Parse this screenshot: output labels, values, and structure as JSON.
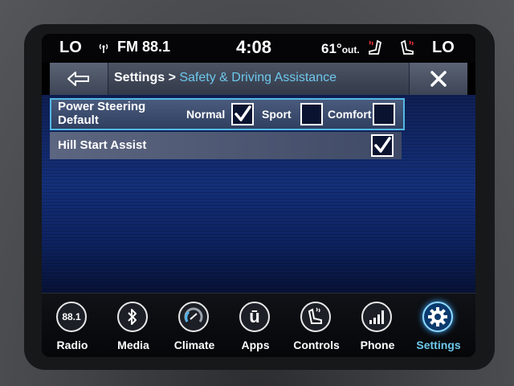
{
  "status_bar": {
    "left_fan": "LO",
    "radio": "FM 88.1",
    "time": "4:08",
    "temperature": "61°",
    "temperature_suffix": "out.",
    "right_fan": "LO",
    "icons": [
      "radio-signal-icon",
      "heated-seat-driver-icon",
      "heated-seat-passenger-icon"
    ]
  },
  "header": {
    "back_icon": "back-arrow-icon",
    "breadcrumb_root": "Settings >",
    "breadcrumb_current": "Safety & Driving Assistance",
    "close_icon": "close-icon"
  },
  "settings": {
    "power_steering": {
      "label_line1": "Power Steering",
      "label_line2": "Default",
      "options": [
        {
          "label": "Normal",
          "checked": true
        },
        {
          "label": "Sport",
          "checked": false
        },
        {
          "label": "Comfort",
          "checked": false
        }
      ]
    },
    "hill_start_assist": {
      "label": "Hill Start Assist",
      "checked": true
    }
  },
  "nav": {
    "items": [
      {
        "label": "Radio",
        "icon": "radio-icon",
        "icon_text": "88.1"
      },
      {
        "label": "Media",
        "icon": "bluetooth-icon"
      },
      {
        "label": "Climate",
        "icon": "climate-icon"
      },
      {
        "label": "Apps",
        "icon": "apps-icon",
        "icon_text": "ū"
      },
      {
        "label": "Controls",
        "icon": "seat-controls-icon"
      },
      {
        "label": "Phone",
        "icon": "phone-signal-icon"
      },
      {
        "label": "Settings",
        "icon": "gear-icon",
        "active": true
      }
    ]
  },
  "colors": {
    "accent": "#6ec8ec",
    "selection_border": "#53b9e5"
  }
}
